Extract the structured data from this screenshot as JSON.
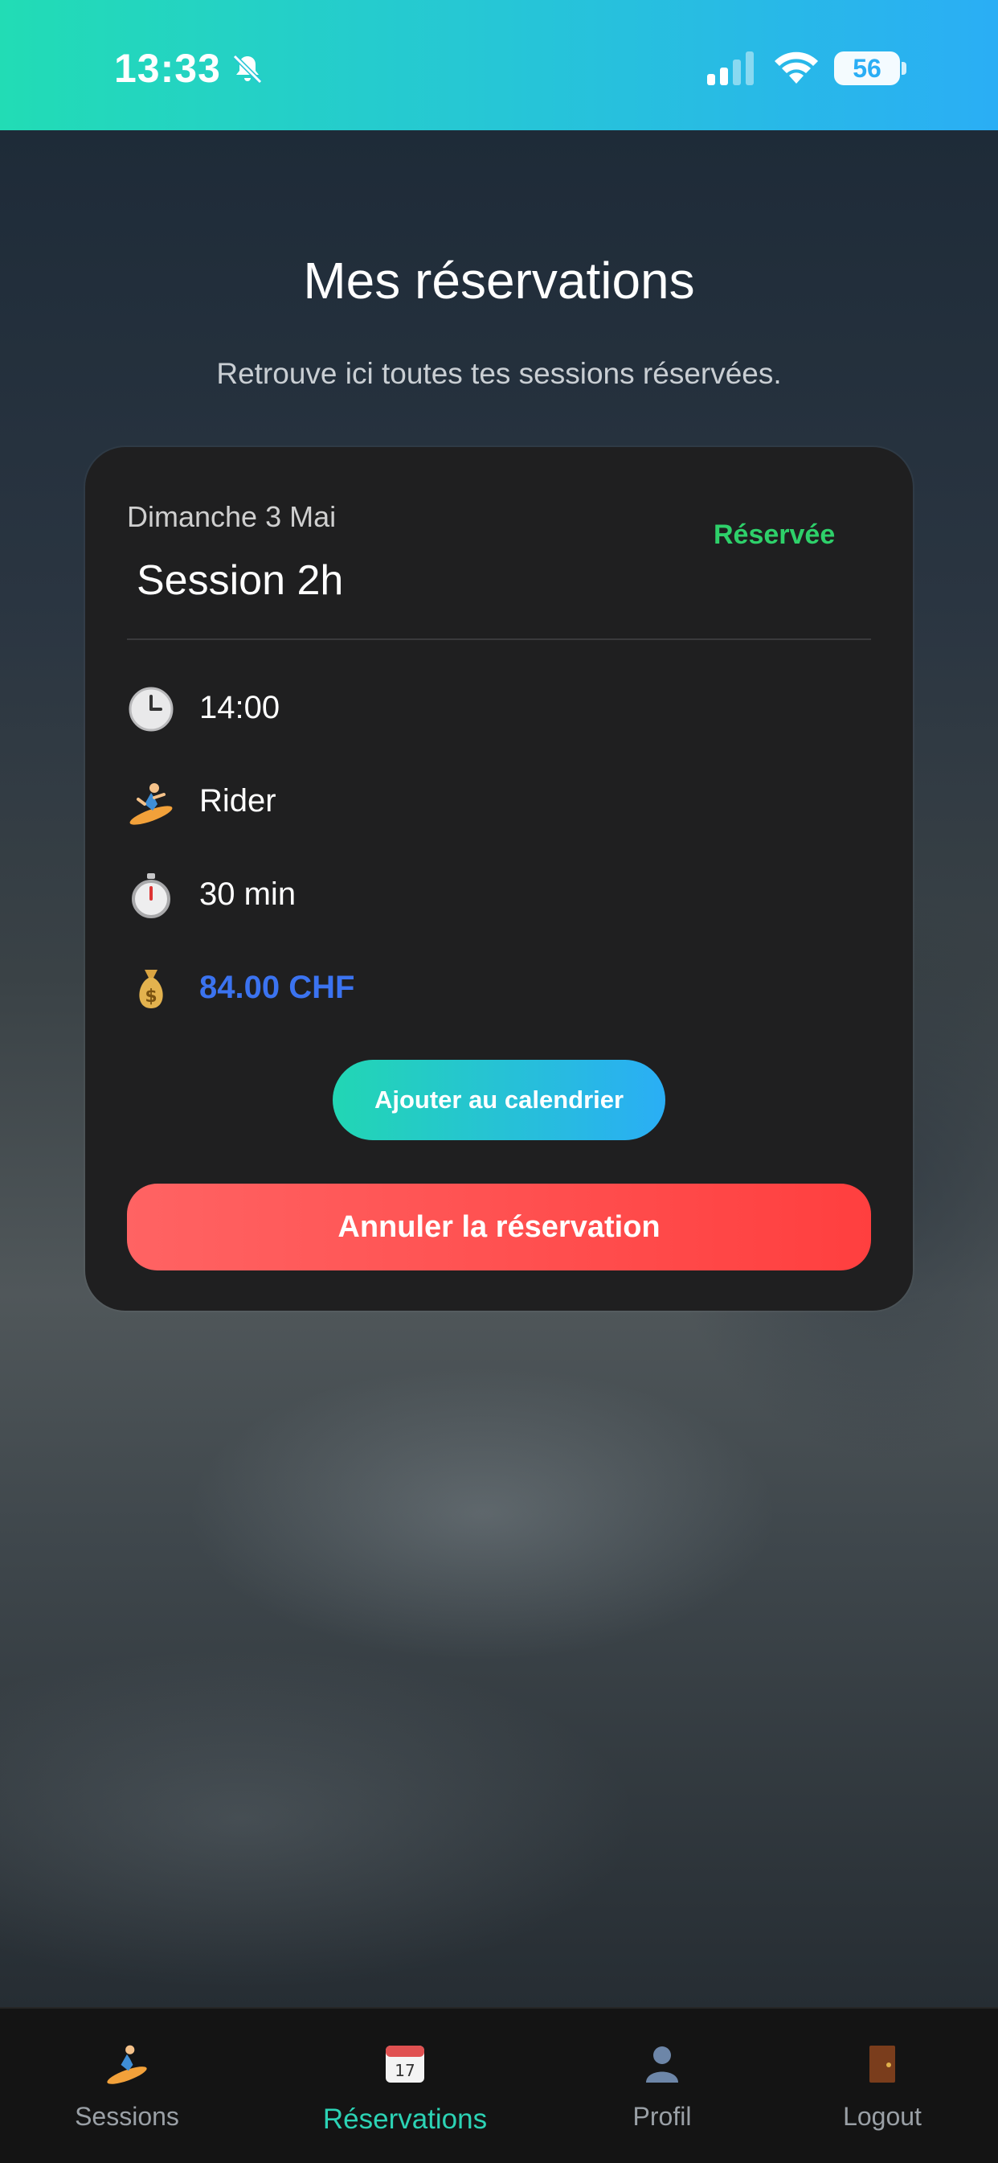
{
  "status_bar": {
    "time": "13:33",
    "battery": "56"
  },
  "page": {
    "title": "Mes réservations",
    "subtitle": "Retrouve ici toutes tes sessions réservées."
  },
  "reservation": {
    "date": "Dimanche 3 Mai",
    "status": "Réservée",
    "session_name": "Session 2h",
    "time": "14:00",
    "role": "Rider",
    "duration": "30 min",
    "price": "84.00 CHF",
    "add_calendar_label": "Ajouter au calendrier",
    "cancel_label": "Annuler la réservation"
  },
  "tabs": [
    {
      "label": "Sessions",
      "icon": "surfer-icon"
    },
    {
      "label": "Réservations",
      "icon": "calendar-icon"
    },
    {
      "label": "Profil",
      "icon": "user-icon"
    },
    {
      "label": "Logout",
      "icon": "door-icon"
    }
  ],
  "colors": {
    "accent_green": "#2cd3b5",
    "status_green": "#2ed06a",
    "price_blue": "#3b73f0",
    "cancel_red": "#ff4a4a"
  }
}
